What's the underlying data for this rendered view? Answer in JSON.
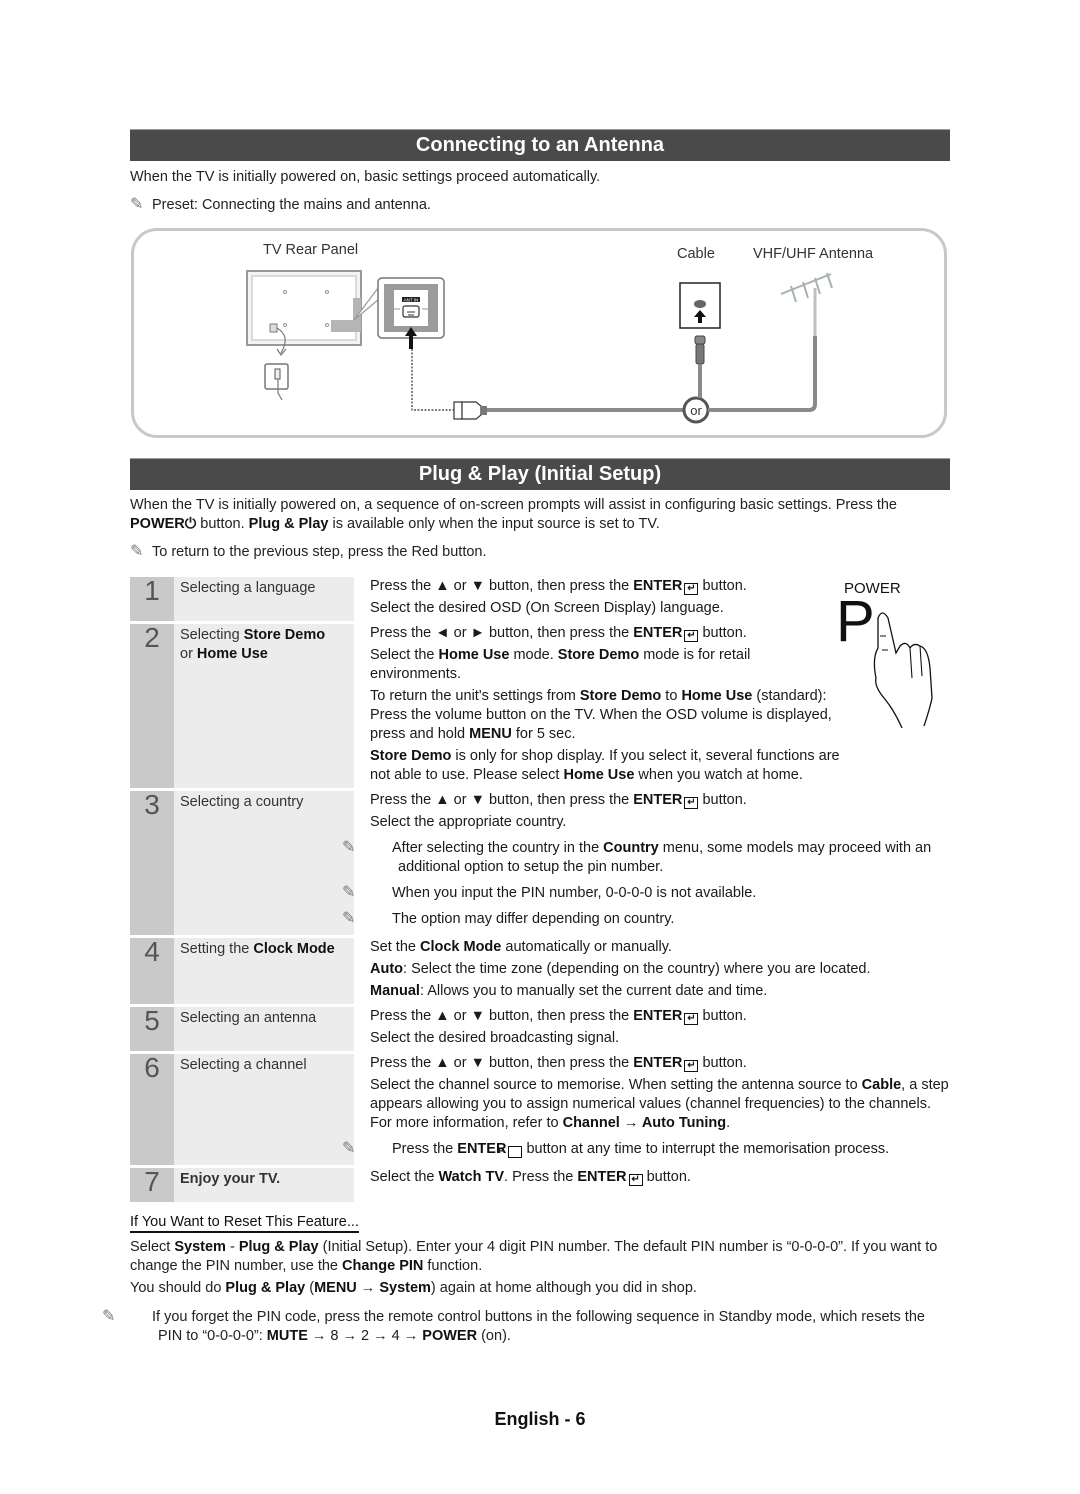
{
  "antenna_section": {
    "title": "Connecting to an Antenna",
    "intro": "When the TV is initially powered on, basic settings proceed automatically.",
    "note": "Preset: Connecting the mains and antenna.",
    "diagram": {
      "tv_rear_panel_label": "TV Rear Panel",
      "ant_in_label": "ANT IN",
      "cable_label": "Cable",
      "antenna_label": "VHF/UHF Antenna",
      "or_label": "or"
    }
  },
  "plug_play_section": {
    "title": "Plug & Play (Initial Setup)",
    "intro_1": "When the TV is initially powered on, a sequence of on-screen prompts will assist in configuring basic settings. Press the",
    "intro_power": "POWER",
    "intro_2": "button.",
    "intro_plug_play": "Plug & Play",
    "intro_3": "is available only when the input source is set to TV.",
    "note": "To return to the previous step, press the Red button.",
    "power_figure_label": "POWER",
    "power_figure_letter": "P"
  },
  "steps": [
    {
      "number": "1",
      "title": "Selecting a language",
      "lines": [
        {
          "pre": "Press the ▲ or ▼ button, then press the ",
          "enter": "ENTER",
          "post": " button."
        },
        {
          "text": "Select the desired OSD (On Screen Display) language."
        }
      ]
    },
    {
      "number": "2",
      "title_pre": "Selecting ",
      "title_b1": "Store Demo",
      "title_mid": "or ",
      "title_b2": "Home Use",
      "lines": [
        {
          "pre": "Press the ◄ or ► button, then press the ",
          "enter": "ENTER",
          "post": " button."
        },
        {
          "p1": "Select the ",
          "b1": "Home Use",
          "p2": " mode. ",
          "b2": "Store Demo",
          "p3": " mode is for retail environments."
        },
        {
          "p1": "To return the unit's settings from ",
          "b1": "Store Demo",
          "p2": " to ",
          "b2": "Home Use",
          "p3": " (standard): Press the volume button on the TV. When the OSD volume is displayed, press and hold ",
          "b3": "MENU",
          "p4": " for 5 sec."
        },
        {
          "b1": "Store Demo",
          "p1": " is only for shop display. If you select it, several functions are not able to use. Please select ",
          "b2": "Home Use",
          "p2": " when you watch at home."
        }
      ]
    },
    {
      "number": "3",
      "title": "Selecting a country",
      "lines": [
        {
          "pre": "Press the ▲ or ▼ button, then press the ",
          "enter": "ENTER",
          "post": " button."
        },
        {
          "text": "Select the appropriate country."
        }
      ],
      "notes": [
        {
          "p1": "After selecting the country in the ",
          "b1": "Country",
          "p2": " menu, some models may proceed with an additional option to setup the pin number."
        },
        {
          "text": "When you input the PIN number, 0-0-0-0 is not available."
        },
        {
          "text": "The option may differ depending on country."
        }
      ]
    },
    {
      "number": "4",
      "title_pre": "Setting the ",
      "title_b1": "Clock Mode",
      "lines": [
        {
          "p1": "Set the ",
          "b1": "Clock Mode",
          "p2": " automatically or manually."
        },
        {
          "b1": "Auto",
          "p1": ": Select the time zone (depending on the country) where you are located."
        },
        {
          "b1": "Manual",
          "p1": ": Allows you to manually set the current date and time."
        }
      ]
    },
    {
      "number": "5",
      "title": "Selecting an antenna",
      "lines": [
        {
          "pre": "Press the ▲ or ▼ button, then press the ",
          "enter": "ENTER",
          "post": " button."
        },
        {
          "text": "Select the desired broadcasting signal."
        }
      ]
    },
    {
      "number": "6",
      "title": "Selecting a channel",
      "lines": [
        {
          "pre": "Press the ▲ or ▼ button, then press the ",
          "enter": "ENTER",
          "post": " button."
        },
        {
          "p1": "Select the channel source to memorise. When setting the antenna source to ",
          "b1": "Cable",
          "p2": ", a step appears allowing you to assign numerical values (channel frequencies) to the channels. For more information, refer to ",
          "b2": "Channel → Auto Tuning",
          "p3": "."
        }
      ],
      "notes": [
        {
          "p1": "Press the ",
          "enter": "ENTER",
          "p2": " button at any time to interrupt the memorisation process."
        }
      ]
    },
    {
      "number": "7",
      "title": "Enjoy your TV.",
      "lines": [
        {
          "p1": "Select the ",
          "b1": "Watch TV",
          "p2": ". Press the ",
          "enter": "ENTER",
          "p3": " button."
        }
      ]
    }
  ],
  "reset": {
    "heading": "If You Want to Reset This Feature...",
    "p1_a": "Select ",
    "p1_b1": "System",
    "p1_b": " - ",
    "p1_b2": "Plug & Play",
    "p1_c": " (Initial Setup). Enter your 4 digit PIN number. The default PIN number is “0-0-0-0”. If you want to change the PIN number, use the ",
    "p1_b3": "Change PIN",
    "p1_d": " function.",
    "p2_a": "You should do ",
    "p2_b1": "Plug & Play",
    "p2_b": " (",
    "p2_b2": "MENU",
    "p2_c": " → ",
    "p2_b3": "System",
    "p2_d": ") again at home although you did in shop.",
    "note_a": "If you forget the PIN code, press the remote control buttons in the following sequence in Standby mode, which resets the PIN to “0-0-0-0”: ",
    "note_b1": "MUTE",
    "note_b": " → 8 → 2 → 4 → ",
    "note_b2": "POWER",
    "note_c": " (on)."
  },
  "footer": {
    "page_label": "English - 6"
  }
}
